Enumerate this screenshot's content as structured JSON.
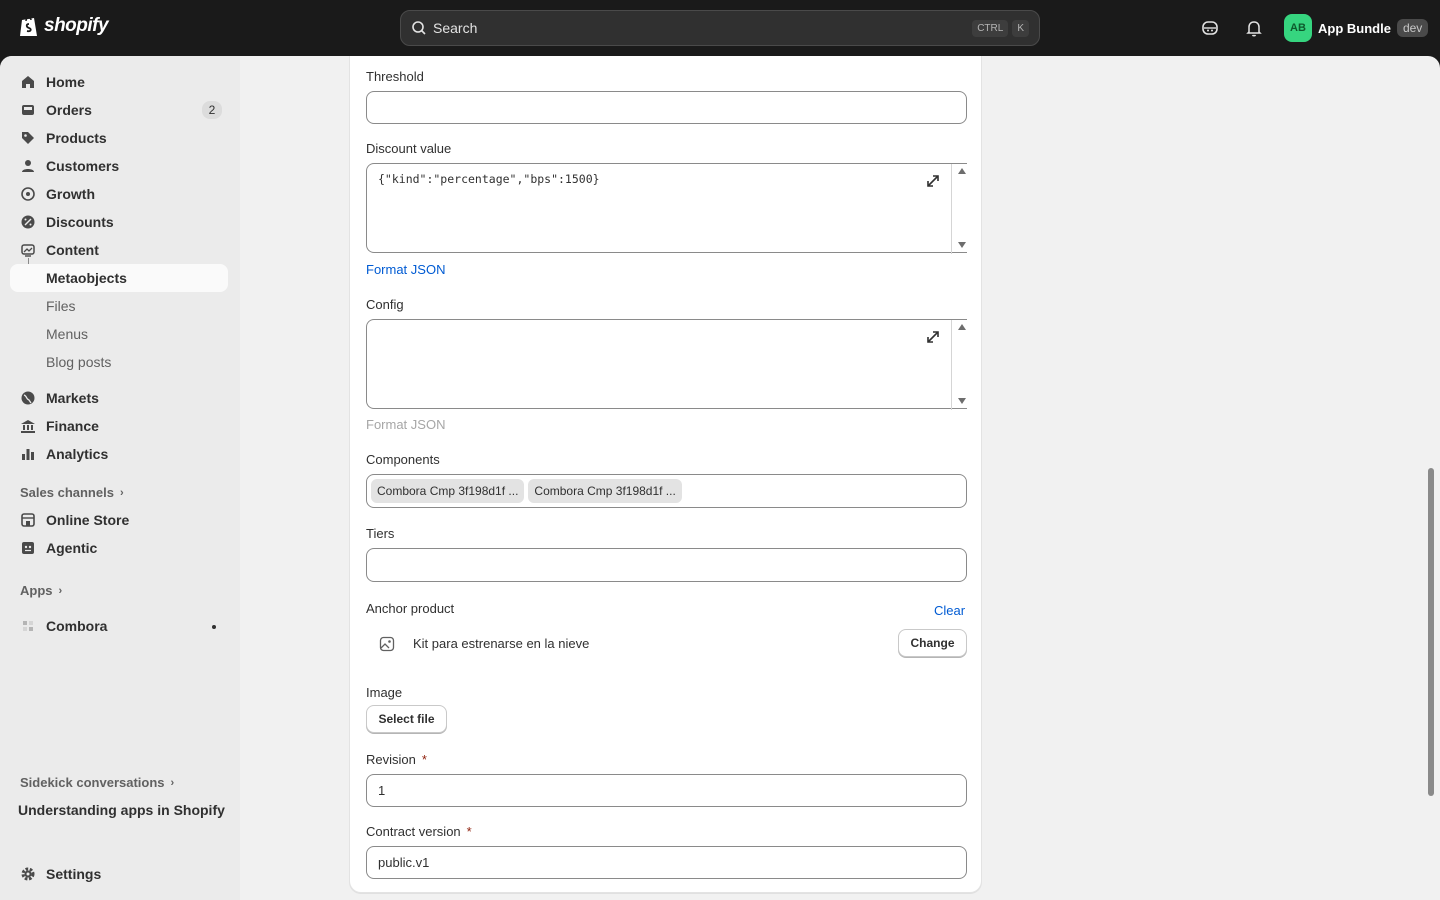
{
  "topbar": {
    "logo_text": "shopify",
    "search_placeholder": "Search",
    "shortcut_key1": "CTRL",
    "shortcut_key2": "K",
    "store_initials": "AB",
    "store_name": "App Bundle",
    "store_badge": "dev"
  },
  "sidebar": {
    "home": "Home",
    "orders": "Orders",
    "orders_count": "2",
    "products": "Products",
    "customers": "Customers",
    "growth": "Growth",
    "discounts": "Discounts",
    "content": "Content",
    "metaobjects": "Metaobjects",
    "files": "Files",
    "menus": "Menus",
    "blog_posts": "Blog posts",
    "markets": "Markets",
    "finance": "Finance",
    "analytics": "Analytics",
    "sales_channels": "Sales channels",
    "online_store": "Online Store",
    "agentic": "Agentic",
    "apps": "Apps",
    "combora": "Combora",
    "sidekick": "Sidekick conversations",
    "sidekick_item": "Understanding apps in Shopify",
    "settings": "Settings"
  },
  "form": {
    "threshold_label": "Threshold",
    "threshold_value": "",
    "discount_label": "Discount value",
    "discount_value": "{\"kind\":\"percentage\",\"bps\":1500}",
    "format_json_1": "Format JSON",
    "config_label": "Config",
    "config_value": "",
    "format_json_2": "Format JSON",
    "components_label": "Components",
    "components": [
      "Combora Cmp 3f198d1f ...",
      "Combora Cmp 3f198d1f ..."
    ],
    "tiers_label": "Tiers",
    "anchor_label": "Anchor product",
    "clear_label": "Clear",
    "anchor_product_name": "Kit para estrenarse en la nieve",
    "change_label": "Change",
    "image_label": "Image",
    "select_file_label": "Select file",
    "revision_label": "Revision",
    "required_mark": "*",
    "revision_value": "1",
    "contract_label": "Contract version",
    "contract_value": "public.v1"
  },
  "colors": {
    "accent_link": "#005bd3",
    "avatar_bg": "#36d57f",
    "topbar_bg": "#1a1a1a"
  }
}
